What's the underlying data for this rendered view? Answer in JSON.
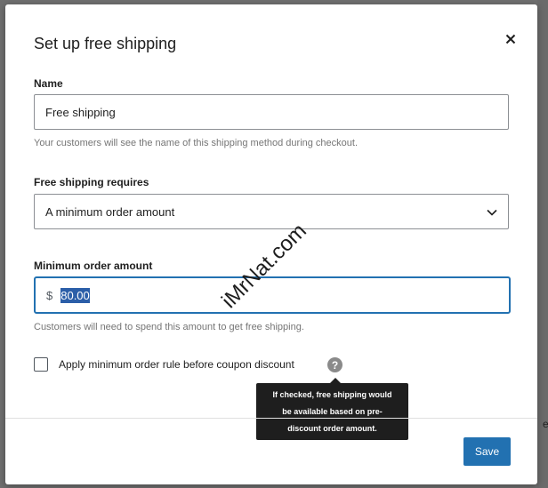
{
  "background": {
    "edge_text": "e"
  },
  "modal": {
    "title": "Set up free shipping",
    "close_icon": "close-icon"
  },
  "name_field": {
    "label": "Name",
    "value": "Free shipping",
    "help": "Your customers will see the name of this shipping method during checkout."
  },
  "requires_field": {
    "label": "Free shipping requires",
    "selected": "A minimum order amount",
    "icon": "chevron-down-icon"
  },
  "amount_field": {
    "label": "Minimum order amount",
    "currency": "$",
    "value": "80.00",
    "help": "Customers will need to spend this amount to get free shipping."
  },
  "coupon_option": {
    "label": "Apply minimum order rule before coupon discount",
    "checked": false,
    "help_icon": "question-icon",
    "help_glyph": "?",
    "tooltip_lines": [
      "If checked, free shipping would",
      "be available based on pre-",
      "discount order amount."
    ]
  },
  "footer": {
    "save_label": "Save"
  },
  "watermark": {
    "text": "iMrNat.com"
  },
  "colors": {
    "primary": "#2271b1",
    "overlay": "#6f6f6f",
    "tooltip": "#1e1e1e"
  }
}
